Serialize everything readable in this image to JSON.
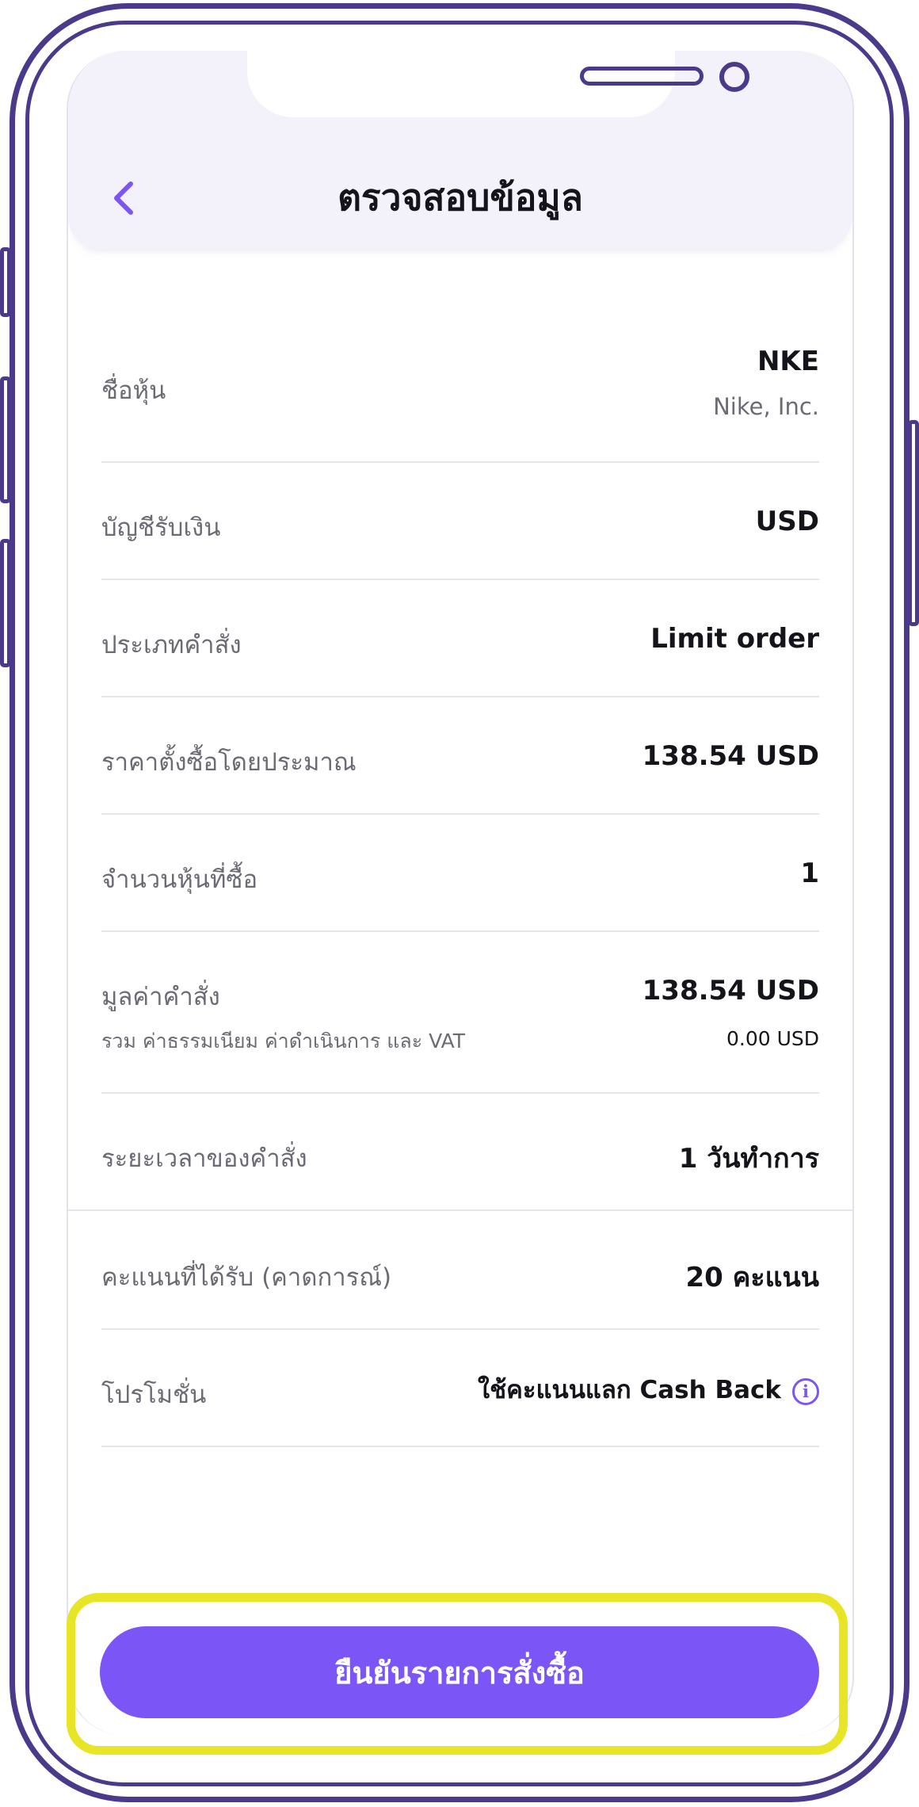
{
  "header": {
    "title": "ตรวจสอบข้อมูล",
    "back_icon": "chevron-left-icon",
    "accent_color": "#7c55f2"
  },
  "stock": {
    "label": "ชื่อหุ้น",
    "symbol": "NKE",
    "company": "Nike, Inc."
  },
  "account": {
    "label": "บัญชีรับเงิน",
    "value": "USD"
  },
  "order_type": {
    "label": "ประเภทคำสั่ง",
    "value": "Limit order"
  },
  "est_price": {
    "label": "ราคาตั้งซื้อโดยประมาณ",
    "value": "138.54 USD"
  },
  "quantity": {
    "label": "จำนวนหุ้นที่ซื้อ",
    "value": "1"
  },
  "order_value": {
    "label": "มูลค่าคำสั่ง",
    "value": "138.54 USD",
    "fee_label": "รวม ค่าธรรมเนียม ค่าดำเนินการ และ VAT",
    "fee_value": "0.00 USD"
  },
  "duration": {
    "label": "ระยะเวลาของคำสั่ง",
    "value": "1 วันทำการ"
  },
  "points": {
    "label": "คะแนนที่ได้รับ (คาดการณ์)",
    "value": "20 คะแนน"
  },
  "promotion": {
    "label": "โปรโมชั่น",
    "value": "ใช้คะแนนแลก Cash Back",
    "info_icon_glyph": "i",
    "info_icon": "info-circle-icon"
  },
  "confirm": {
    "label": "ยืนยันรายการสั่งซื้อ",
    "button_color": "#7c55f7",
    "highlight_color": "#e8e526"
  }
}
